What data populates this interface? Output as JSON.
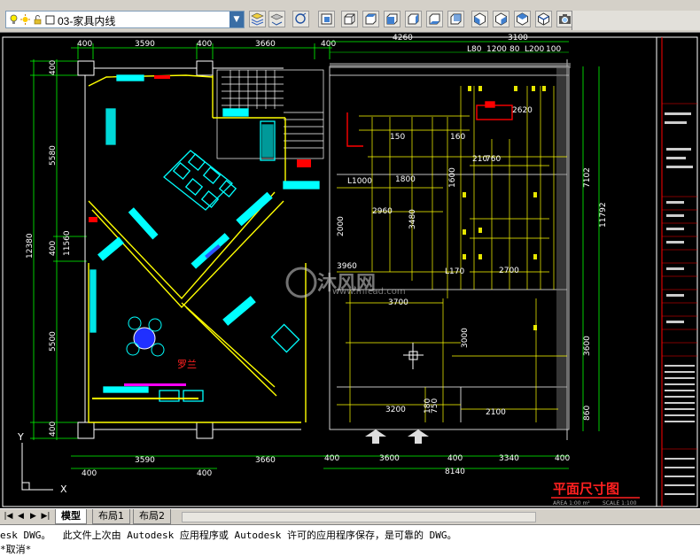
{
  "toolbar": {
    "layer_name": "03-家具内线",
    "icons": [
      "bulb-icon",
      "sun-icon",
      "unlock-icon",
      "color-square-icon",
      "layer-properties-icon",
      "layer-previous-icon",
      "layer-state-icon",
      "3dorbit-icon",
      "front-view-icon",
      "top-view-icon",
      "left-view-icon",
      "right-view-icon",
      "bottom-view-icon",
      "iso-sw-icon",
      "iso-se-icon",
      "iso-ne-icon",
      "iso-nw-icon",
      "camera-icon"
    ]
  },
  "drawing": {
    "title": "平面尺寸图",
    "subtitle_left": "AREA 1:00 m²",
    "subtitle_right": "SCALE 1:100",
    "label_luolan": "罗兰",
    "watermark_brand": "沐风网",
    "watermark_url": "www.mfcad.com",
    "top_dims_left": [
      "400",
      "3590",
      "400",
      "3660",
      "400"
    ],
    "top_dims_right": [
      "4260",
      "3100"
    ],
    "top_small_dims": [
      "L80",
      "1200",
      "80",
      "L200",
      "100"
    ],
    "bottom_dims_left": [
      "3590",
      "3660"
    ],
    "bottom_dims_left2": [
      "400",
      "400"
    ],
    "bottom_dims_right": [
      "400",
      "3600",
      "400",
      "3340",
      "400"
    ],
    "bottom_total": "8140",
    "left_dims": [
      "400",
      "5580",
      "11560",
      "400",
      "5500",
      "400"
    ],
    "left_total": "12380",
    "right_dims": [
      "7102",
      "11792",
      "3600",
      "860"
    ],
    "inner_dims": [
      "2620",
      "1800",
      "2960",
      "3480",
      "2000",
      "2700",
      "3700",
      "3000",
      "3200",
      "2100",
      "L1000",
      "L170",
      "3960",
      "1600",
      "160",
      "150",
      "210",
      "760",
      "750",
      "180"
    ],
    "y_axis_label": "Y",
    "origin_x_label": "X"
  },
  "tabs": {
    "model": "模型",
    "layout1": "布局1",
    "layout2": "布局2"
  },
  "command_line": {
    "line1": "esk DWG。  此文件上次由 Autodesk 应用程序或 Autodesk 许可的应用程序保存，是可靠的 DWG。",
    "line2": "*取消*"
  }
}
